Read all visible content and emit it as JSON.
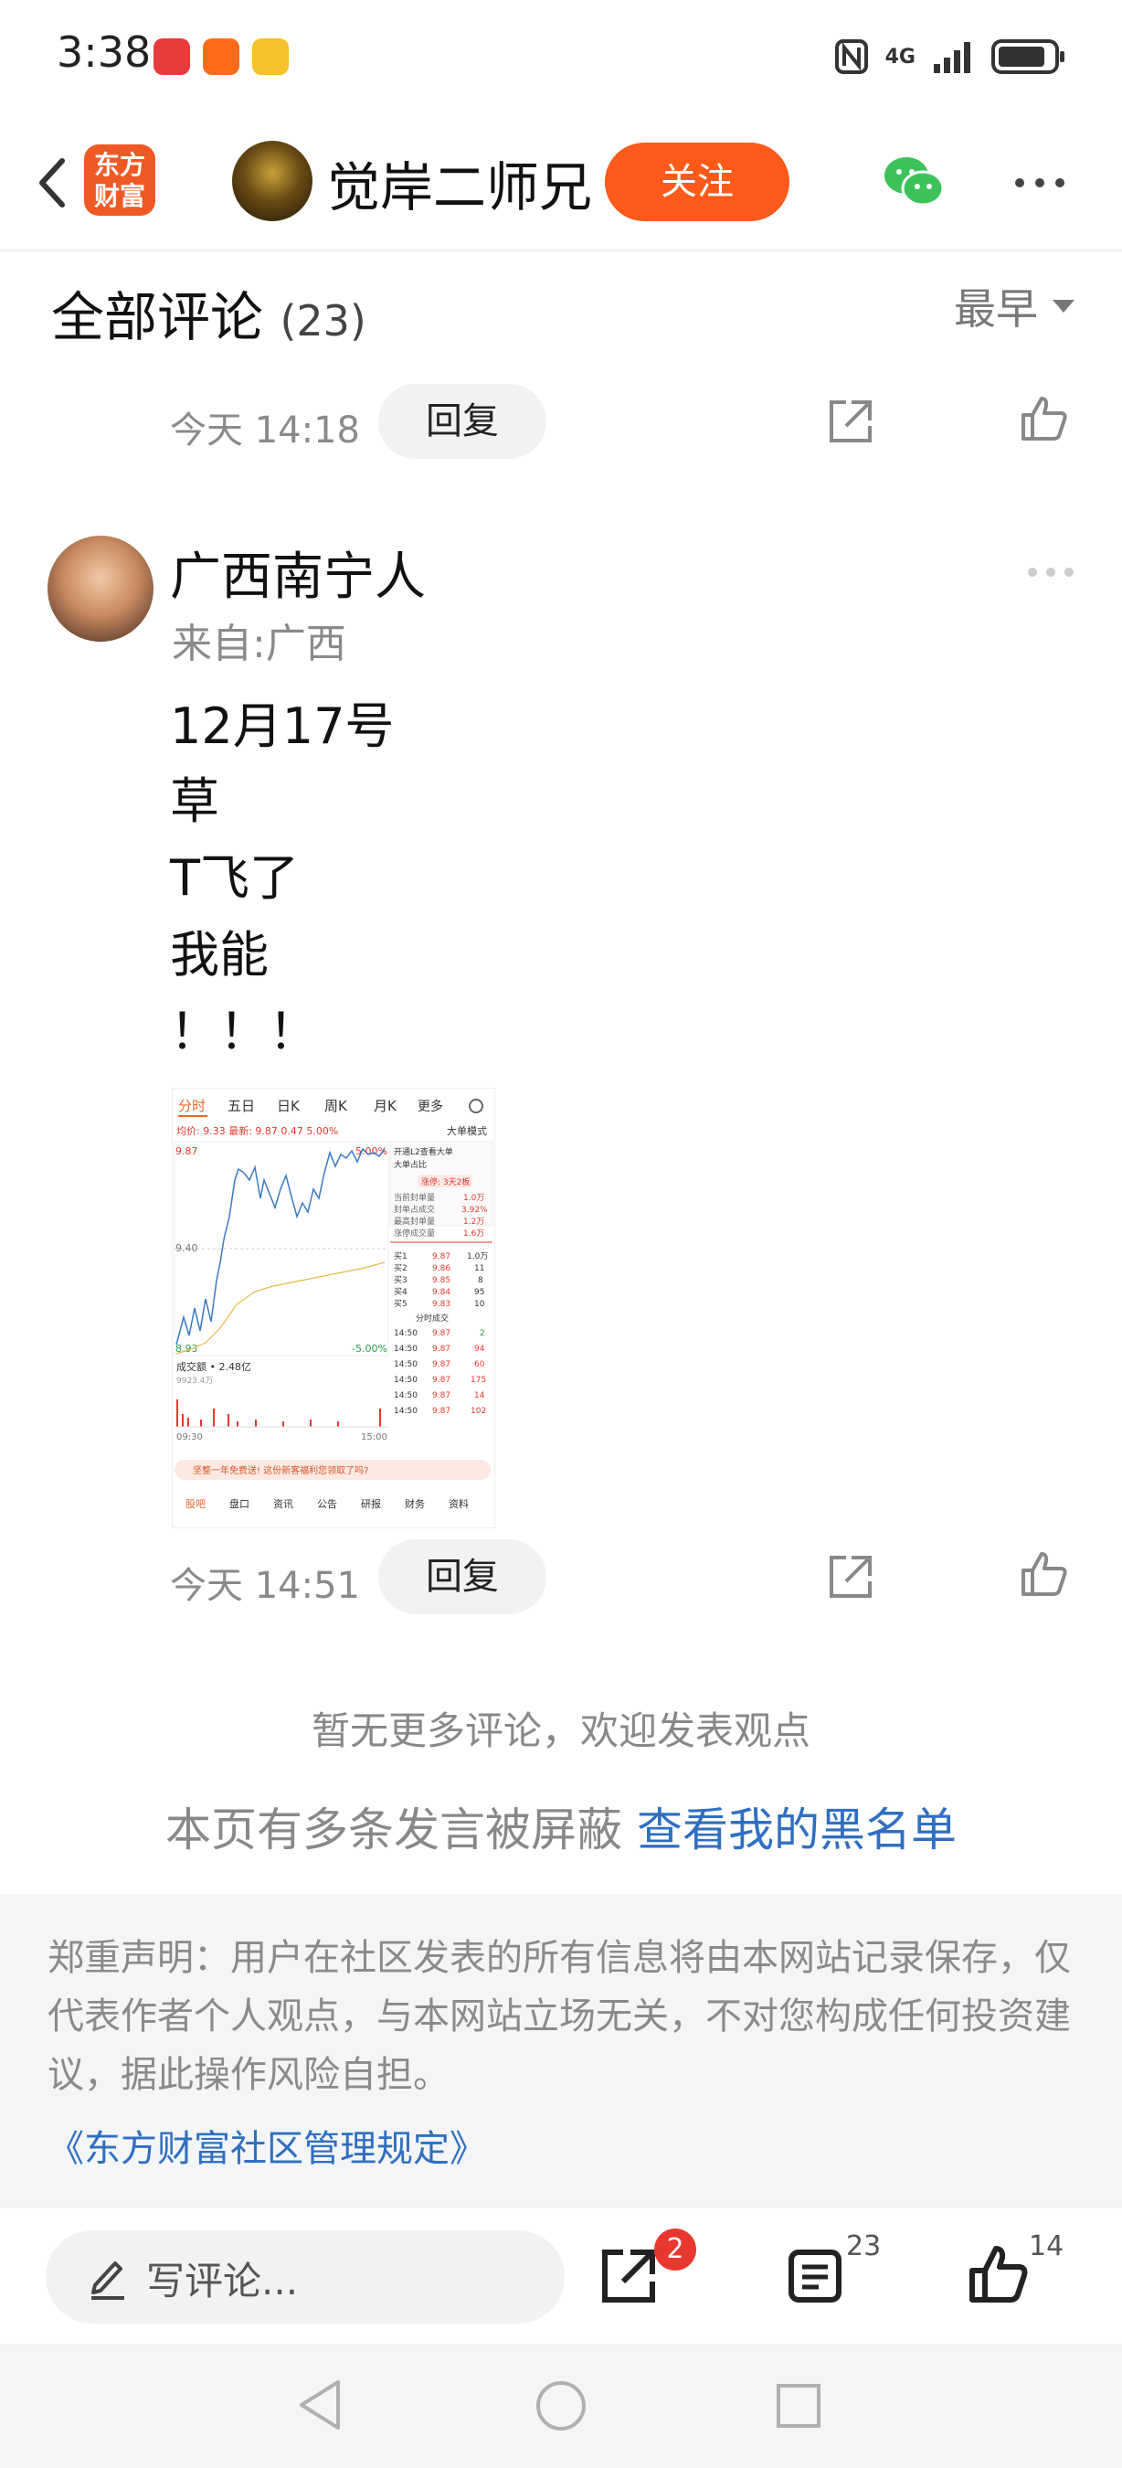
{
  "status_bar": {
    "time": "3:38",
    "app_icons": [
      "huawei-app-icon",
      "forward-app-icon",
      "weibo-icon"
    ],
    "network": "4G",
    "icons": [
      "nfc-icon",
      "signal-icon",
      "battery-icon"
    ]
  },
  "header": {
    "back_icon": "chevron-left-icon",
    "brand_logo": "东方财富",
    "author_name": "觉岸二师兄",
    "follow_label": "关注",
    "wechat_icon": "wechat-icon",
    "more_icon": "more-dots-icon"
  },
  "comments_section": {
    "title": "全部评论",
    "count": "(23)",
    "sort_label": "最早"
  },
  "previous_comment": {
    "time": "今天 14:18",
    "reply_label": "回复"
  },
  "comment": {
    "author": "广西南宁人",
    "location": "来自:广西",
    "lines": [
      "12月17号",
      "草",
      "T飞了",
      "我能",
      "！！！"
    ],
    "time": "今天 14:51",
    "reply_label": "回复",
    "image": {
      "tabs": [
        "分时",
        "五日",
        "日K",
        "周K",
        "月K",
        "更多"
      ],
      "header_info": "均价: 9.33  最新: 9.87  0.47  5.00%",
      "mode_label": "大单模式",
      "price_high": "9.87",
      "price_mid": "9.40",
      "price_low": "8.93",
      "pct_high": "5.00%",
      "pct_low": "-5.00%",
      "volume_label": "成交额 • 2.48亿",
      "volume_top": "9923.4万",
      "time_start": "09:30",
      "time_end": "15:00",
      "panel_title": "开通L2查看大单",
      "panel_row": "大单占比",
      "limit_up": "涨停: 3天2板",
      "stats": [
        {
          "label": "当前封单量",
          "value": "1.0万"
        },
        {
          "label": "封单占成交",
          "value": "3.92%"
        },
        {
          "label": "最高封单量",
          "value": "1.2万"
        },
        {
          "label": "涨停成交量",
          "value": "1.6万"
        }
      ],
      "bids": [
        {
          "label": "买1",
          "price": "9.87",
          "vol": "1.0万"
        },
        {
          "label": "买2",
          "price": "9.86",
          "vol": "11"
        },
        {
          "label": "买3",
          "price": "9.85",
          "vol": "8"
        },
        {
          "label": "买4",
          "price": "9.84",
          "vol": "95"
        },
        {
          "label": "买5",
          "price": "9.83",
          "vol": "10"
        }
      ],
      "trades_title": "分时成交",
      "trades": [
        {
          "t": "14:50",
          "p": "9.87",
          "v": "2"
        },
        {
          "t": "14:50",
          "p": "9.87",
          "v": "94"
        },
        {
          "t": "14:50",
          "p": "9.87",
          "v": "60"
        },
        {
          "t": "14:50",
          "p": "9.87",
          "v": "175"
        },
        {
          "t": "14:50",
          "p": "9.87",
          "v": "14"
        },
        {
          "t": "14:50",
          "p": "9.87",
          "v": "102"
        }
      ],
      "banner": "坚整一年免费送! 这份新客福利您领取了吗?",
      "bottom_tabs": [
        "股吧",
        "盘口",
        "资讯",
        "公告",
        "研报",
        "财务",
        "资料"
      ]
    }
  },
  "footer": {
    "no_more": "暂无更多评论，欢迎发表观点",
    "blocked_text": "本页有多条发言被屏蔽",
    "blacklist_link": "查看我的黑名单",
    "disclaimer": "郑重声明：用户在社区发表的所有信息将由本网站记录保存，仅代表作者个人观点，与本网站立场无关，不对您构成任何投资建议，据此操作风险自担。",
    "rules_link": "《东方财富社区管理规定》"
  },
  "bottom_bar": {
    "comment_placeholder": "写评论...",
    "share_badge": "2",
    "comment_count": "23",
    "like_count": "14"
  },
  "colors": {
    "accent_orange": "#ff5a1a",
    "link_blue": "#2f6fc1",
    "badge_red": "#e8372e",
    "brand_orange": "#ef5a24"
  }
}
